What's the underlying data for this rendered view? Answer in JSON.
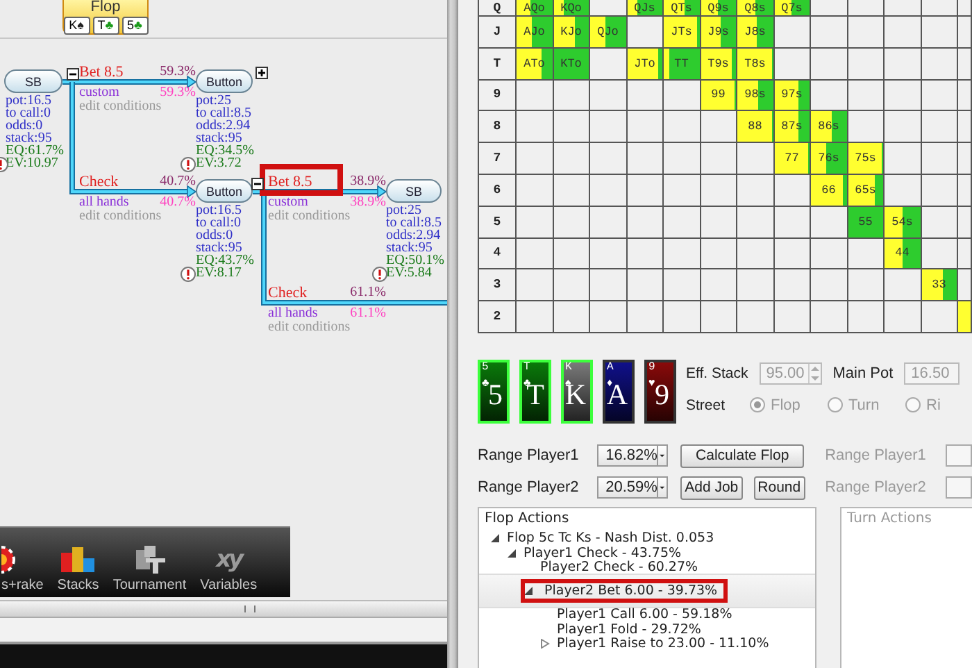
{
  "flop_badge": {
    "title": "Flop",
    "cards": [
      {
        "rank": "K",
        "suit": "♠",
        "color": "#222222"
      },
      {
        "rank": "T",
        "suit": "♣",
        "color": "#1a9a1a"
      },
      {
        "rank": "5",
        "suit": "♣",
        "color": "#1a9a1a"
      }
    ]
  },
  "game_tree": {
    "nodes": [
      {
        "player": "SB",
        "warning": true,
        "stats": [
          {
            "text": "pot:16.5",
            "kind": "info"
          },
          {
            "text": "to call:0",
            "kind": "info"
          },
          {
            "text": "odds:0",
            "kind": "info"
          },
          {
            "text": "stack:95",
            "kind": "info"
          },
          {
            "text": "EQ:61.7%",
            "kind": "result"
          },
          {
            "text": "EV:10.97",
            "kind": "result"
          }
        ]
      },
      {
        "player": "Button",
        "warning": true,
        "expanded": false,
        "stats": [
          {
            "text": "pot:25",
            "kind": "info"
          },
          {
            "text": "to call:8.5",
            "kind": "info"
          },
          {
            "text": "odds:2.94",
            "kind": "info"
          },
          {
            "text": "stack:95",
            "kind": "info"
          },
          {
            "text": "EQ:34.5%",
            "kind": "result"
          },
          {
            "text": "EV:3.72",
            "kind": "result"
          }
        ]
      },
      {
        "player": "Button",
        "warning": true,
        "stats": [
          {
            "text": "pot:16.5",
            "kind": "info"
          },
          {
            "text": "to call:0",
            "kind": "info"
          },
          {
            "text": "odds:0",
            "kind": "info"
          },
          {
            "text": "stack:95",
            "kind": "info"
          },
          {
            "text": "EQ:43.7%",
            "kind": "result"
          },
          {
            "text": "EV:8.17",
            "kind": "result"
          }
        ]
      },
      {
        "player": "SB",
        "warning": true,
        "stats": [
          {
            "text": "pot:25",
            "kind": "info"
          },
          {
            "text": "to call:8.5",
            "kind": "info"
          },
          {
            "text": "odds:2.94",
            "kind": "info"
          },
          {
            "text": "stack:95",
            "kind": "info"
          },
          {
            "text": "EQ:50.1%",
            "kind": "result"
          },
          {
            "text": "EV:5.84",
            "kind": "result"
          }
        ]
      }
    ],
    "actions": [
      {
        "label": "Bet 8.5",
        "share": "59.3%",
        "range": "custom",
        "range_share": "59.3%",
        "edit": "edit conditions",
        "expanded": true,
        "highlighted": false
      },
      {
        "label": "Check",
        "share": "40.7%",
        "range": "all hands",
        "range_share": "40.7%",
        "edit": "edit conditions",
        "highlighted": false
      },
      {
        "label": "Bet 8.5",
        "share": "38.9%",
        "range": "custom",
        "range_share": "38.9%",
        "edit": "edit conditions",
        "expanded": true,
        "highlighted": true
      },
      {
        "label": "Check",
        "share": "61.1%",
        "range": "all hands",
        "range_share": "61.1%",
        "edit": "edit conditions",
        "highlighted": false
      }
    ]
  },
  "toolbar": [
    {
      "kind": "rake",
      "label": "s+rake"
    },
    {
      "kind": "stacks",
      "label": "Stacks"
    },
    {
      "kind": "tournament",
      "label": "Tournament"
    },
    {
      "kind": "variables",
      "label": "Variables",
      "glyph": "xy"
    }
  ],
  "hand_grid": {
    "rows": [
      {
        "label": "Q",
        "cells": [
          {
            "text": "AQo",
            "level": 0.6
          },
          {
            "text": "KQo",
            "level": 0.7
          },
          null,
          {
            "text": "QJs",
            "level": 0.7
          },
          {
            "text": "QTs",
            "level": 0.4
          },
          {
            "text": "Q9s",
            "level": 0.5
          },
          {
            "text": "Q8s",
            "level": 0.5
          },
          {
            "text": "Q7s",
            "level": 0.5
          },
          null,
          null,
          null,
          null,
          null
        ]
      },
      {
        "label": "J",
        "cells": [
          {
            "text": "AJo",
            "level": 0.55
          },
          {
            "text": "KJo",
            "level": 0.4
          },
          {
            "text": "QJo",
            "level": 0.55
          },
          null,
          {
            "text": "JTs",
            "level": 0.05
          },
          {
            "text": "J9s",
            "level": 0.45
          },
          {
            "text": "J8s",
            "level": 0.45
          },
          null,
          null,
          null,
          null,
          null,
          null
        ]
      },
      {
        "label": "T",
        "cells": [
          {
            "text": "ATo",
            "level": 0.3
          },
          {
            "text": "KTo",
            "level": 1
          },
          null,
          {
            "text": "JTo",
            "level": 0.1
          },
          {
            "text": "TT",
            "level": 0.85
          },
          {
            "text": "T9s",
            "level": 0.1
          },
          {
            "text": "T8s",
            "level": 0
          },
          null,
          null,
          null,
          null,
          null,
          null
        ]
      },
      {
        "label": "9",
        "cells": [
          null,
          null,
          null,
          null,
          null,
          {
            "text": "99",
            "level": 0
          },
          {
            "text": "98s",
            "level": 0.4
          },
          {
            "text": "97s",
            "level": 0.3
          },
          null,
          null,
          null,
          null,
          null
        ]
      },
      {
        "label": "8",
        "cells": [
          null,
          null,
          null,
          null,
          null,
          null,
          {
            "text": "88",
            "level": 0
          },
          {
            "text": "87s",
            "level": 0.3
          },
          {
            "text": "86s",
            "level": 0.4
          },
          null,
          null,
          null,
          null
        ]
      },
      {
        "label": "7",
        "cells": [
          null,
          null,
          null,
          null,
          null,
          null,
          null,
          {
            "text": "77",
            "level": 0
          },
          {
            "text": "76s",
            "level": 0.55
          },
          {
            "text": "75s",
            "level": 0.05
          },
          null,
          null,
          null
        ]
      },
      {
        "label": "6",
        "cells": [
          null,
          null,
          null,
          null,
          null,
          null,
          null,
          null,
          {
            "text": "66",
            "level": 0.1
          },
          {
            "text": "65s",
            "level": 0.25
          },
          null,
          null,
          null
        ]
      },
      {
        "label": "5",
        "cells": [
          null,
          null,
          null,
          null,
          null,
          null,
          null,
          null,
          null,
          {
            "text": "55",
            "level": 1
          },
          {
            "text": "54s",
            "level": 0.5
          },
          null,
          null
        ]
      },
      {
        "label": "4",
        "cells": [
          null,
          null,
          null,
          null,
          null,
          null,
          null,
          null,
          null,
          null,
          {
            "text": "44",
            "level": 0.5
          },
          null,
          null
        ]
      },
      {
        "label": "3",
        "cells": [
          null,
          null,
          null,
          null,
          null,
          null,
          null,
          null,
          null,
          null,
          null,
          {
            "text": "33",
            "level": 0.4
          },
          null
        ]
      },
      {
        "label": "2",
        "cells": [
          null,
          null,
          null,
          null,
          null,
          null,
          null,
          null,
          null,
          null,
          null,
          null,
          {}
        ]
      }
    ]
  },
  "board": {
    "cards": [
      {
        "corner": "5",
        "suit": "♣",
        "rank": "5",
        "color": "#0a7a0a",
        "selected": true
      },
      {
        "corner": "T",
        "suit": "♣",
        "rank": "T",
        "color": "#0a7a0a",
        "selected": true
      },
      {
        "corner": "K",
        "suit": "♠",
        "rank": "K",
        "color": "#7a7a7a",
        "selected": true
      },
      {
        "corner": "A",
        "suit": "♦",
        "rank": "A",
        "color": "#10108a",
        "selected": false
      },
      {
        "corner": "9",
        "suit": "♥",
        "rank": "9",
        "color": "#8a0a0a",
        "selected": false
      }
    ]
  },
  "eff_stack": {
    "label": "Eff. Stack",
    "value": "95.00",
    "disabled": true
  },
  "main_pot": {
    "label": "Main Pot",
    "value": "16.50",
    "disabled": true
  },
  "street": {
    "label": "Street",
    "disabled": true,
    "options": [
      {
        "label": "Flop",
        "selected": true
      },
      {
        "label": "Turn",
        "selected": false
      },
      {
        "label": "Ri",
        "selected": false
      }
    ]
  },
  "ranges": [
    {
      "label": "Range Player1",
      "value": "16.82%",
      "buttons": [
        "Calculate Flop"
      ],
      "mirror_label": "Range Player1",
      "mirror_disabled": true
    },
    {
      "label": "Range Player2",
      "value": "20.59%",
      "buttons": [
        "Add Job",
        "Round"
      ],
      "mirror_label": "Range Player2",
      "mirror_disabled": true
    }
  ],
  "flop_actions": {
    "title": "Flop Actions",
    "items": [
      {
        "label": "Flop 5c Tc Ks - Nash Dist. 0.053",
        "expanded": true,
        "selected": false,
        "highlighted": false,
        "children": [
          {
            "label": "Player1 Check - 43.75%",
            "expanded": true,
            "selected": false,
            "highlighted": false,
            "children": [
              {
                "label": "Player2 Check - 60.27%",
                "selected": false,
                "highlighted": false
              },
              {
                "label": "Player2 Bet 6.00 - 39.73%",
                "expanded": true,
                "selected": true,
                "highlighted": true,
                "children": [
                  {
                    "label": "Player1 Call 6.00 - 59.18%",
                    "selected": false,
                    "highlighted": false
                  },
                  {
                    "label": "Player1 Fold - 29.72%",
                    "selected": false,
                    "highlighted": false
                  },
                  {
                    "label": "Player1 Raise to 23.00 - 11.10%",
                    "expanded": false,
                    "selected": false,
                    "highlighted": false
                  }
                ]
              }
            ]
          }
        ]
      }
    ]
  },
  "turn_actions": {
    "title": "Turn Actions",
    "disabled": true
  }
}
